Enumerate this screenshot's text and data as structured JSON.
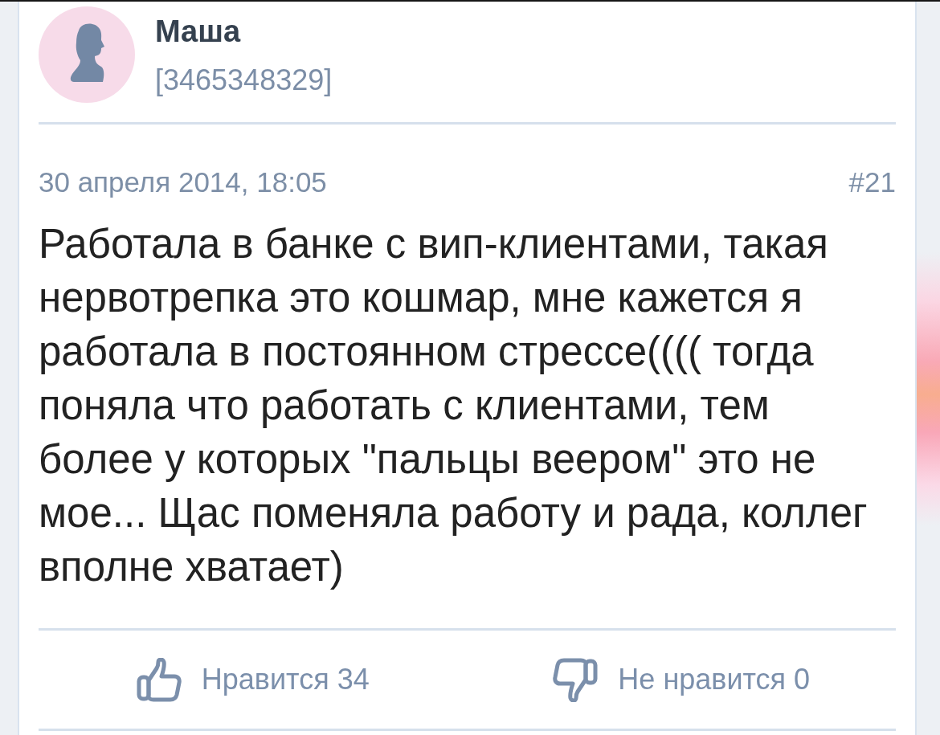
{
  "author": {
    "name": "Маша",
    "id": "[3465348329]"
  },
  "post": {
    "date": "30 апреля 2014, 18:05",
    "number": "#21",
    "text": "Работала в банке с вип-клиентами, такая нервотрепка это кошмар, мне кажется я работала в постоянном стрессе(((( тогда поняла что работать с клиентами, тем более у которых \"пальцы веером\" это не мое... Щас поменяла работу и рада, коллег вполне хватает)"
  },
  "reactions": [
    {
      "kind": "like",
      "label": "Нравится 34"
    },
    {
      "kind": "dislike",
      "label": "Не нравится 0"
    }
  ]
}
